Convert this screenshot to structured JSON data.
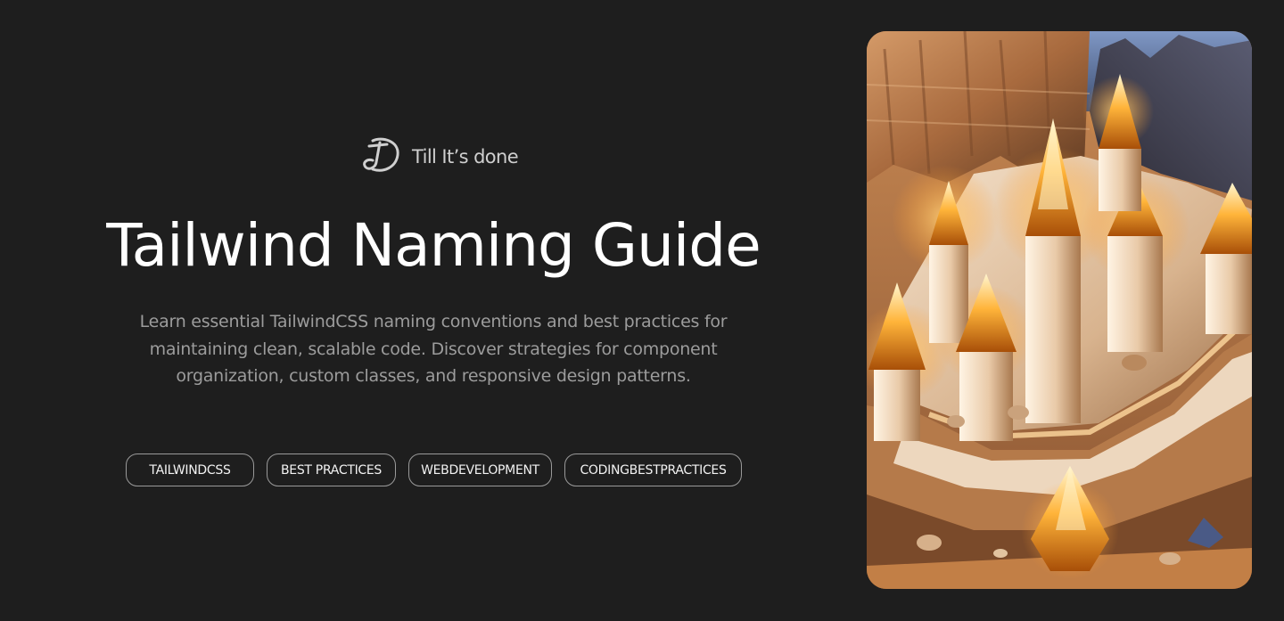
{
  "brand": {
    "name": "Till It’s done",
    "logo_icon": "td-monogram-logo"
  },
  "hero": {
    "title": "Tailwind Naming Guide",
    "description": "Learn essential TailwindCSS naming conventions and best practices for maintaining clean, scalable code. Discover strategies for component organization, custom classes, and responsive design patterns.",
    "tags": [
      "TAILWINDCSS",
      "BEST PRACTICES",
      "WEBDEVELOPMENT",
      "CODINGBESTPRACTICES"
    ]
  },
  "image": {
    "subject": "glowing-crystals-in-canyon-illustration"
  },
  "colors": {
    "background": "#1e1e1e",
    "title": "#ffffff",
    "description": "#9c9c9c",
    "tag_border": "#9a9a9a",
    "tag_text": "#f2f2f2",
    "brand_text": "#cfcfcf"
  }
}
